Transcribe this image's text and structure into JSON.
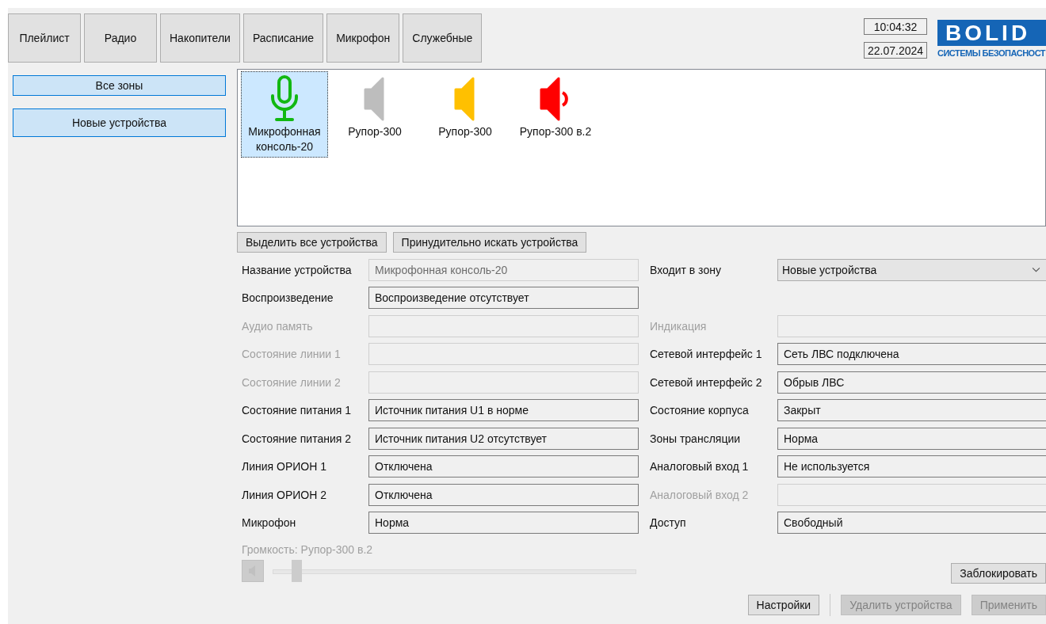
{
  "tabs": [
    {
      "label": "Плейлист",
      "selected": false
    },
    {
      "label": "Радио",
      "selected": false
    },
    {
      "label": "Накопители",
      "selected": false
    },
    {
      "label": "Расписание",
      "selected": false
    },
    {
      "label": "Микрофон",
      "selected": false
    },
    {
      "label": "Служебные",
      "selected": false
    }
  ],
  "clock": {
    "time": "10:04:32",
    "date": "22.07.2024"
  },
  "logo": {
    "name": "BOLID",
    "tagline": "СИСТЕМЫ БЕЗОПАСНОСТ"
  },
  "zones": [
    {
      "label": "Все зоны",
      "selected": false
    },
    {
      "label": "Новые устройства",
      "selected": true
    }
  ],
  "devices": [
    {
      "kind": "microphone",
      "label": "Микрофонная консоль-20",
      "color": "#12b812",
      "selected": true
    },
    {
      "kind": "speaker",
      "label": "Рупор-300",
      "color": "#bdbdbd",
      "selected": false
    },
    {
      "kind": "speaker",
      "label": "Рупор-300",
      "color": "#ffc000",
      "selected": false
    },
    {
      "kind": "speaker-sound",
      "label": "Рупор-300 в.2",
      "color": "#ff0000",
      "selected": false
    }
  ],
  "device_actions": [
    "Выделить все устройства",
    "Принудительно искать устройства"
  ],
  "fields": [
    {
      "left": {
        "label": "Название устройства",
        "value": "Микрофонная консоль-20",
        "disabled": false,
        "dimmed_value": true
      },
      "right": {
        "kind": "dropdown",
        "label": "Входит в зону",
        "value": "Новые устройства",
        "disabled": false
      }
    },
    {
      "left": {
        "label": "Воспроизведение",
        "value": "Воспроизведение отсутствует",
        "disabled": false,
        "dimmed_value": false
      },
      "right": {
        "kind": "blank"
      }
    },
    {
      "left": {
        "label": "Аудио память",
        "disabled": true,
        "dimmed_value": false
      },
      "right": {
        "kind": "text",
        "label": "Индикация",
        "disabled": true
      }
    },
    {
      "left": {
        "label": "Состояние линии 1",
        "disabled": true,
        "dimmed_value": false
      },
      "right": {
        "kind": "text",
        "label": "Сетевой интерфейс 1",
        "value": "Сеть ЛВС подключена",
        "disabled": false
      }
    },
    {
      "left": {
        "label": "Состояние линии 2",
        "disabled": true,
        "dimmed_value": false
      },
      "right": {
        "kind": "text",
        "label": "Сетевой интерфейс 2",
        "value": "Обрыв ЛВС",
        "disabled": false
      }
    },
    {
      "left": {
        "label": "Состояние питания 1",
        "value": "Источник питания U1 в норме",
        "disabled": false,
        "dimmed_value": false
      },
      "right": {
        "kind": "text",
        "label": "Состояние корпуса",
        "value": "Закрыт",
        "disabled": false
      }
    },
    {
      "left": {
        "label": "Состояние питания 2",
        "value": "Источник питания U2 отсутствует",
        "disabled": false,
        "dimmed_value": false
      },
      "right": {
        "kind": "text",
        "label": "Зоны трансляции",
        "value": "Норма",
        "disabled": false
      }
    },
    {
      "left": {
        "label": "Линия ОРИОН 1",
        "value": "Отключена",
        "disabled": false,
        "dimmed_value": false
      },
      "right": {
        "kind": "text",
        "label": "Аналоговый вход 1",
        "value": "Не используется",
        "disabled": false
      }
    },
    {
      "left": {
        "label": "Линия ОРИОН 2",
        "value": "Отключена",
        "disabled": false,
        "dimmed_value": false
      },
      "right": {
        "kind": "text",
        "label": "Аналоговый вход 2",
        "disabled": true
      }
    },
    {
      "left": {
        "label": "Микрофон",
        "value": "Норма",
        "disabled": false,
        "dimmed_value": false
      },
      "right": {
        "kind": "text",
        "label": "Доступ",
        "value": "Свободный",
        "disabled": false
      }
    }
  ],
  "volume": {
    "label": "Громкость: Рупор-300 в.2",
    "level": 0.065,
    "disabled": true
  },
  "lock_button": {
    "label": "Заблокировать",
    "disabled": false
  },
  "footer_buttons": [
    {
      "label": "Настройки",
      "disabled": false
    },
    {
      "label": "Удалить устройства",
      "disabled": true
    },
    {
      "label": "Применить",
      "disabled": true
    }
  ]
}
